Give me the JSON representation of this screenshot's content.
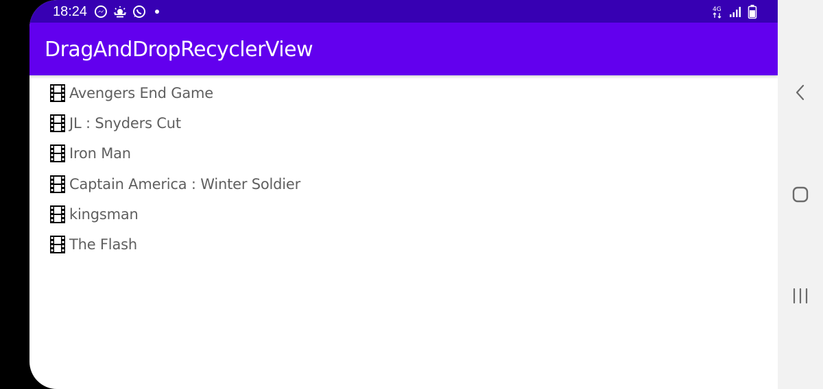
{
  "status_bar": {
    "time": "18:24",
    "network": "4G",
    "left_icons": [
      "messenger-icon",
      "weather-icon",
      "whatsapp-icon",
      "notification-dot-icon"
    ],
    "right_icons": [
      "network-4g-icon",
      "signal-icon",
      "battery-icon"
    ]
  },
  "app_bar": {
    "title": "DragAndDropRecyclerView"
  },
  "movies": [
    {
      "label": "Avengers End Game"
    },
    {
      "label": "JL : Snyders Cut"
    },
    {
      "label": "Iron Man"
    },
    {
      "label": "Captain America : Winter Soldier"
    },
    {
      "label": "kingsman"
    },
    {
      "label": "The Flash"
    }
  ],
  "nav_bar": {
    "buttons": [
      "back-icon",
      "home-icon",
      "recents-icon"
    ]
  },
  "colors": {
    "status_bar": "#3700b3",
    "app_bar": "#6200ee",
    "item_text": "#5f5f5f",
    "nav_bar": "#f2f2f2"
  }
}
